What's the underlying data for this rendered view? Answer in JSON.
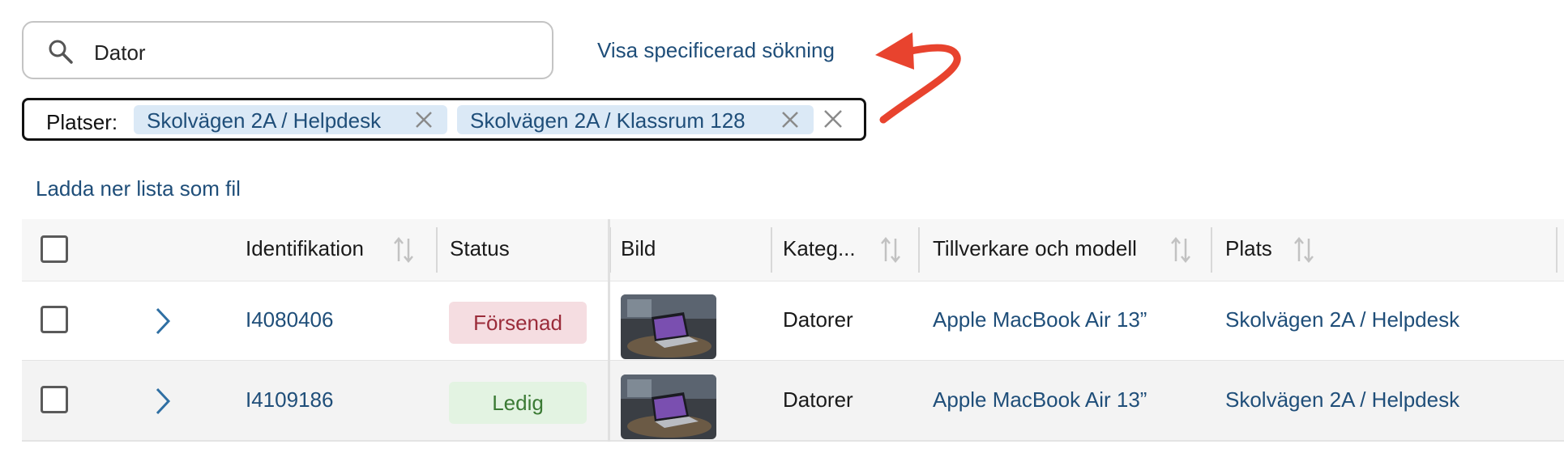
{
  "search": {
    "value": "Dator",
    "icon": "search-icon"
  },
  "advanced_search_link": "Visa specificerad sökning",
  "filter": {
    "label": "Platser:",
    "chips": [
      {
        "label": "Skolvägen 2A / Helpdesk"
      },
      {
        "label": "Skolvägen 2A / Klassrum 128"
      }
    ]
  },
  "download_link": "Ladda ner lista som fil",
  "table": {
    "columns": {
      "identification": "Identifikation",
      "status": "Status",
      "image": "Bild",
      "category": "Kateg...",
      "manufacturer_model": "Tillverkare och modell",
      "location": "Plats"
    },
    "rows": [
      {
        "id": "I4080406",
        "status": "Försenad",
        "status_color": "#f5dde1",
        "status_text_color": "#9b2c3a",
        "category": "Datorer",
        "model": "Apple MacBook Air 13”",
        "location": "Skolvägen 2A / Helpdesk"
      },
      {
        "id": "I4109186",
        "status": "Ledig",
        "status_color": "#e3f3e2",
        "status_text_color": "#3b7a34",
        "category": "Datorer",
        "model": "Apple MacBook Air 13”",
        "location": "Skolvägen 2A / Helpdesk"
      }
    ]
  },
  "colors": {
    "link": "#1f4e79",
    "chip_bg": "#dbe9f6",
    "annotation_arrow": "#e8432e"
  }
}
